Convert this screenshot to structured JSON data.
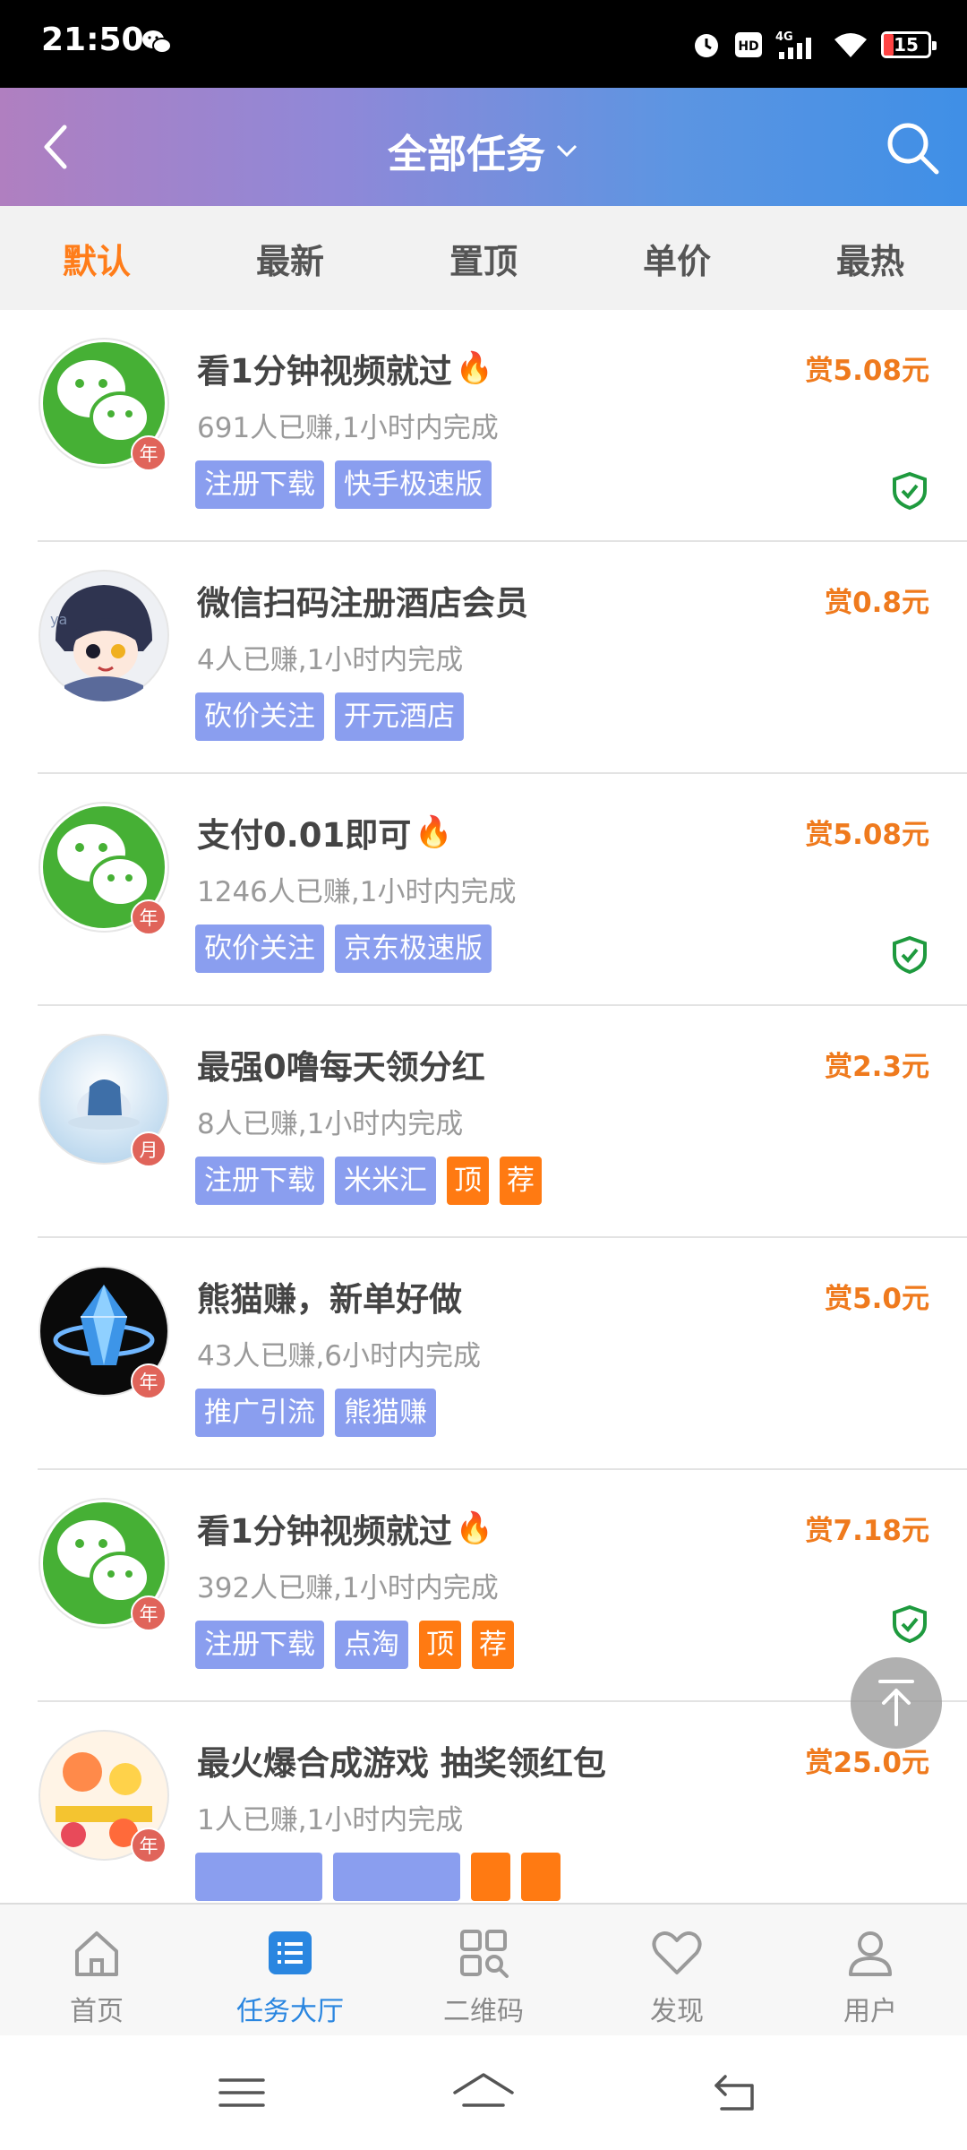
{
  "status_bar": {
    "time": "21:50",
    "network": "4G",
    "hd": "HD",
    "battery": "15"
  },
  "header": {
    "title": "全部任务"
  },
  "sort_tabs": [
    {
      "label": "默认",
      "active": true
    },
    {
      "label": "最新",
      "active": false
    },
    {
      "label": "置顶",
      "active": false
    },
    {
      "label": "单价",
      "active": false
    },
    {
      "label": "最热",
      "active": false
    }
  ],
  "tasks": [
    {
      "avatar": "wechat-icon",
      "badge": "年",
      "title": "看1分钟视频就过",
      "hot": true,
      "stats": "691人已赚,1小时内完成",
      "tags": [
        "注册下载",
        "快手极速版"
      ],
      "orange_tags": [],
      "reward": "赏5.08元",
      "verified": true
    },
    {
      "avatar": "anime-avatar",
      "badge": "",
      "title": "微信扫码注册酒店会员",
      "hot": false,
      "stats": "4人已赚,1小时内完成",
      "tags": [
        "砍价关注",
        "开元酒店"
      ],
      "orange_tags": [],
      "reward": "赏0.8元",
      "verified": false
    },
    {
      "avatar": "wechat-icon",
      "badge": "年",
      "title": "支付0.01即可",
      "hot": true,
      "stats": "1246人已赚,1小时内完成",
      "tags": [
        "砍价关注",
        "京东极速版"
      ],
      "orange_tags": [],
      "reward": "赏5.08元",
      "verified": true
    },
    {
      "avatar": "photo-avatar",
      "badge": "月",
      "title": "最强0噜每天领分红",
      "hot": false,
      "stats": "8人已赚,1小时内完成",
      "tags": [
        "注册下载",
        "米米汇"
      ],
      "orange_tags": [
        "顶",
        "荐"
      ],
      "reward": "赏2.3元",
      "verified": false
    },
    {
      "avatar": "crystal-avatar",
      "badge": "年",
      "title": "熊猫赚，新单好做",
      "hot": false,
      "stats": "43人已赚,6小时内完成",
      "tags": [
        "推广引流",
        "熊猫赚"
      ],
      "orange_tags": [],
      "reward": "赏5.0元",
      "verified": false
    },
    {
      "avatar": "wechat-icon",
      "badge": "年",
      "title": "看1分钟视频就过",
      "hot": true,
      "stats": "392人已赚,1小时内完成",
      "tags": [
        "注册下载",
        "点淘"
      ],
      "orange_tags": [
        "顶",
        "荐"
      ],
      "reward": "赏7.18元",
      "verified": true
    },
    {
      "avatar": "game-avatar",
      "badge": "年",
      "title": "最火爆合成游戏 抽奖领红包",
      "hot": false,
      "stats": "1人已赚,1小时内完成",
      "tags": [
        "",
        ""
      ],
      "orange_tags": [
        "",
        ""
      ],
      "reward": "赏25.0元",
      "verified": false
    }
  ],
  "bottom_nav": [
    {
      "label": "首页",
      "icon": "home-icon",
      "active": false
    },
    {
      "label": "任务大厅",
      "icon": "task-list-icon",
      "active": true
    },
    {
      "label": "二维码",
      "icon": "qrcode-icon",
      "active": false
    },
    {
      "label": "发现",
      "icon": "heart-icon",
      "active": false
    },
    {
      "label": "用户",
      "icon": "user-icon",
      "active": false
    }
  ],
  "colors": {
    "accent": "#ef7a1d",
    "tag_blue": "#8a9eef",
    "tag_orange": "#ff7a12",
    "nav_active": "#2a86e0",
    "header_gradient_start": "#b07fc0",
    "header_gradient_end": "#3f8fe6"
  }
}
